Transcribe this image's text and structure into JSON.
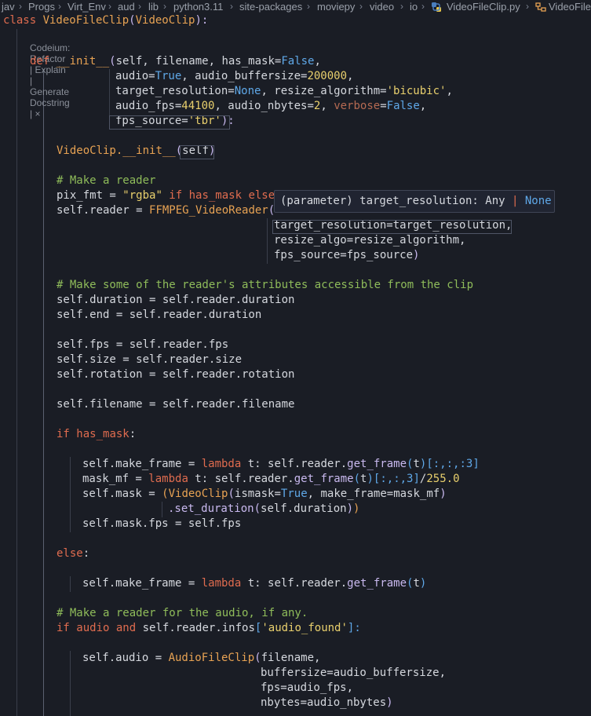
{
  "breadcrumb": {
    "items": [
      "jav",
      "Progs",
      "Virt_Env",
      "aud",
      "lib",
      "python3.11",
      "site-packages",
      "moviepy",
      "video",
      "io",
      "VideoFileClip.py",
      "VideoFile"
    ]
  },
  "codelens": {
    "text": "Codeium: Refactor | Explain | Generate Docstring | ×"
  },
  "hover": {
    "prefix": "(parameter) target_resolution: Any ",
    "pipe": "|",
    "none": " None"
  },
  "code": {
    "l1": {
      "a": "class ",
      "b": "VideoFileClip",
      "c": "(",
      "d": "VideoClip",
      "e": "):"
    },
    "l3": {
      "a": "def ",
      "b": "__init__",
      "c": "(",
      "d": "self, filename, has_mask=",
      "e": "False",
      "f": ","
    },
    "l4": {
      "a": "audio=",
      "b": "True",
      "c": ", audio_buffersize=",
      "d": "200000",
      "e": ","
    },
    "l5": {
      "a": "target_resolution=",
      "b": "None",
      "c": ", resize_algorithm=",
      "d": "'bicubic'",
      "e": ","
    },
    "l6": {
      "a": "audio_fps=",
      "b": "44100",
      "c": ", audio_nbytes=",
      "d": "2",
      "e": ", ",
      "f": "verbose",
      "g": "=",
      "h": "False",
      "i": ","
    },
    "l7": {
      "a": "fps_source=",
      "b": "'tbr'",
      "c": "):"
    },
    "l8": {
      "a": "VideoClip.",
      "b": "__init__",
      "c": "(",
      "d": "self",
      "e": ")"
    },
    "l9": {
      "a": "# Make a reader"
    },
    "l10": {
      "a": "pix_fmt = ",
      "b": "\"rgba\"",
      "c": " if has_mask else"
    },
    "l11": {
      "a": "self.reader = ",
      "b": "FFMPEG_VideoReader",
      "c": "("
    },
    "l12": {
      "a": "target_resolution=target_resolution,"
    },
    "l13": {
      "a": "resize_algo=resize_algorithm,"
    },
    "l14": {
      "a": "fps_source=fps_source",
      "b": ")"
    },
    "l15": {
      "a": "# Make some of the reader's attributes accessible from the clip"
    },
    "l16": {
      "a": "self.duration = self.reader.duration"
    },
    "l17": {
      "a": "self.end = self.reader.duration"
    },
    "l18": {
      "a": "self.fps = self.reader.fps"
    },
    "l19": {
      "a": "self.size = self.reader.size"
    },
    "l20": {
      "a": "self.rotation = self.reader.rotation"
    },
    "l21": {
      "a": "self.filename = self.reader.filename"
    },
    "l22": {
      "a": "if ",
      "b": "has_mask",
      "c": ":"
    },
    "l23": {
      "a": "self.make_frame = ",
      "b": "lambda",
      "c": " t: self.reader.",
      "d": "get_frame",
      "e": "(",
      "f": "t",
      "g": ")",
      "h": "[:,:,:3]"
    },
    "l24": {
      "a": "mask_mf = ",
      "b": "lambda",
      "c": " t: self.reader.",
      "d": "get_frame",
      "e": "(",
      "f": "t",
      "g": ")",
      "h": "[:,:,3]",
      "i": "/",
      "j": "255.0"
    },
    "l25": {
      "a": "self.mask = ",
      "b": "(",
      "c": "VideoClip",
      "d": "(",
      "e": "ismask=",
      "f": "True",
      "g": ", make_frame=mask_mf",
      "h": ")"
    },
    "l26": {
      "a": ".set_duration",
      "b": "(",
      "c": "self.duration",
      "d": ")",
      "e": ")"
    },
    "l27": {
      "a": "self.mask.fps = self.fps"
    },
    "l28": {
      "a": "else",
      "b": ":"
    },
    "l29": {
      "a": "self.make_frame = ",
      "b": "lambda",
      "c": " t: self.reader.",
      "d": "get_frame",
      "e": "(",
      "f": "t",
      "g": ")"
    },
    "l30": {
      "a": "# Make a reader for the audio, if any."
    },
    "l31": {
      "a": "if ",
      "b": "audio",
      "c": " and ",
      "d": "self.reader.infos",
      "e": "[",
      "f": "'audio_found'",
      "g": "]:"
    },
    "l32": {
      "a": "self.audio = ",
      "b": "AudioFileClip",
      "c": "(",
      "d": "filename,"
    },
    "l33": {
      "a": "buffersize=audio_buffersize,"
    },
    "l34": {
      "a": "fps=audio_fps,"
    },
    "l35": {
      "a": "nbytes=audio_nbytes",
      "b": ")"
    }
  },
  "colors": {
    "background": "#1a1d25",
    "keyword": "#e06c4f",
    "function": "#e7a253",
    "string": "#e9d06d",
    "comment": "#8fbc5a",
    "constant": "#5fa8e8"
  }
}
